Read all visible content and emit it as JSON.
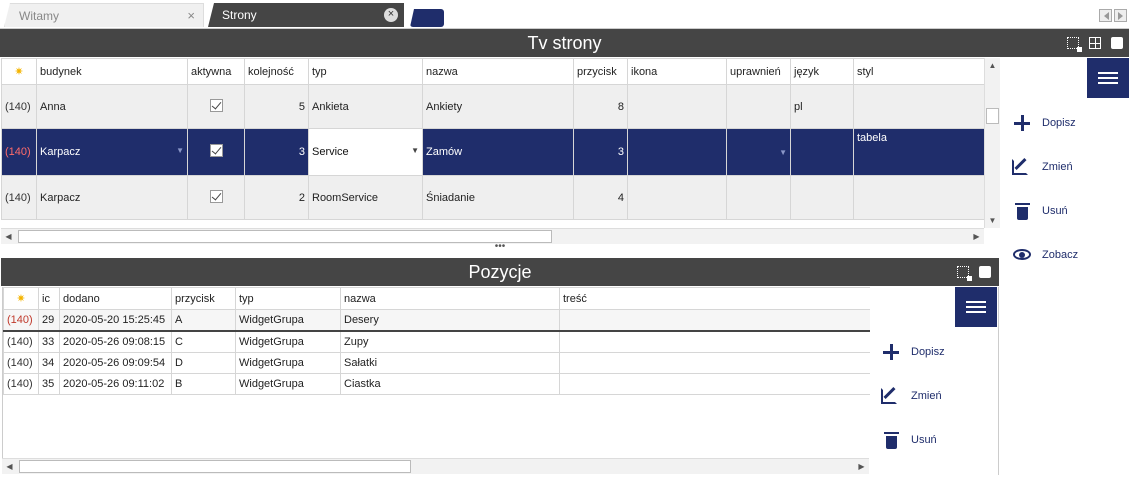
{
  "tabs": [
    {
      "label": "Witamy",
      "close": "×"
    },
    {
      "label": "Strony",
      "close": "×"
    }
  ],
  "top": {
    "title": "Tv strony",
    "columns": [
      "",
      "budynek",
      "aktywna",
      "kolejność",
      "typ",
      "nazwa",
      "przycisk",
      "ikona",
      "uprawnień",
      "język",
      "styl"
    ],
    "rows": [
      {
        "id": "(140)",
        "budynek": "Anna",
        "aktywna": true,
        "kolejnosc": "5",
        "typ": "Ankieta",
        "nazwa": "Ankiety",
        "przycisk": "8",
        "ikona": "",
        "uprawnien": "",
        "jezyk": "pl",
        "styl": ""
      },
      {
        "id": "(140)",
        "budynek": "Karpacz",
        "aktywna": true,
        "kolejnosc": "3",
        "typ": "Service",
        "nazwa": "Zamów",
        "przycisk": "3",
        "ikona": "",
        "uprawnien": "",
        "jezyk": "",
        "styl": "tabela"
      },
      {
        "id": "(140)",
        "budynek": "Karpacz",
        "aktywna": true,
        "kolejnosc": "2",
        "typ": "RoomService",
        "nazwa": "Śniadanie",
        "przycisk": "4",
        "ikona": "",
        "uprawnien": "",
        "jezyk": "",
        "styl": ""
      }
    ],
    "actions": {
      "add": "Dopisz",
      "edit": "Zmień",
      "delete": "Usuń",
      "view": "Zobacz"
    }
  },
  "bottom": {
    "title": "Pozycje",
    "columns": [
      "",
      "ic",
      "dodano",
      "przycisk",
      "typ",
      "nazwa",
      "treść"
    ],
    "rows": [
      {
        "id": "(140)",
        "ic": "29",
        "dodano": "2020-05-20 15:25:45",
        "przycisk": "A",
        "typ": "WidgetGrupa",
        "nazwa": "Desery",
        "tresc": ""
      },
      {
        "id": "(140)",
        "ic": "33",
        "dodano": "2020-05-26 09:08:15",
        "przycisk": "C",
        "typ": "WidgetGrupa",
        "nazwa": "Zupy",
        "tresc": ""
      },
      {
        "id": "(140)",
        "ic": "34",
        "dodano": "2020-05-26 09:09:54",
        "przycisk": "D",
        "typ": "WidgetGrupa",
        "nazwa": "Sałatki",
        "tresc": ""
      },
      {
        "id": "(140)",
        "ic": "35",
        "dodano": "2020-05-26 09:11:02",
        "przycisk": "B",
        "typ": "WidgetGrupa",
        "nazwa": "Ciastka",
        "tresc": ""
      }
    ],
    "actions": {
      "add": "Dopisz",
      "edit": "Zmień",
      "delete": "Usuń"
    }
  },
  "star_glyph": "✷",
  "splitter_glyph": "•••"
}
